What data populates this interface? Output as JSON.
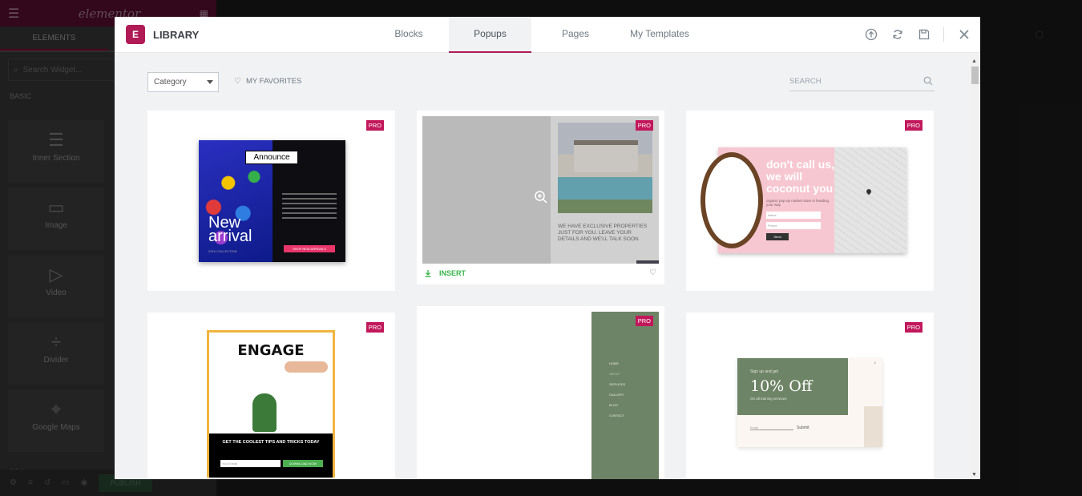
{
  "editor": {
    "logo": "elementor",
    "tab_elements": "ELEMENTS",
    "search_placeholder": "Search Widget...",
    "category_basic": "BASIC",
    "widgets": [
      "Inner Section",
      "Image",
      "Video",
      "Divider",
      "Google Maps"
    ],
    "category_pro": "PRO",
    "publish_label": "PUBLISH"
  },
  "library": {
    "logo_letter": "E",
    "title": "LIBRARY",
    "tabs": [
      "Blocks",
      "Popups",
      "Pages",
      "My Templates"
    ],
    "active_tab": "Popups"
  },
  "toolbar": {
    "category_select": "Category",
    "favorites_label": "MY FAVORITES",
    "search_placeholder": "SEARCH"
  },
  "cards": [
    {
      "badge": "PRO",
      "title_tag": "Announce",
      "headline": "New arrival",
      "sub": "2019 COLLECTION",
      "button": "SHOP NEW ARRIVALS"
    },
    {
      "badge": "PRO",
      "text": "WE HAVE EXCLUSIVE PROPERTIES JUST FOR YOU. LEAVE YOUR DETAILS AND WE'LL TALK SOON",
      "insert_label": "INSERT"
    },
    {
      "badge": "PRO",
      "headline": "don't call us, we will coconut you",
      "sub": "organic pop-up market store is heading your way",
      "field1": "Name",
      "field2": "Phone",
      "button": "Send"
    },
    {
      "badge": "PRO",
      "headline": "ENGAGE",
      "sub": "GET THE COOLEST TIPS AND TRICKS TODAY",
      "field": "Your Email",
      "button": "DOWNLOAD NOW"
    },
    {
      "badge": "PRO",
      "menu": [
        "HOME",
        "ABOUT",
        "SERVICES",
        "GALLERY",
        "BLOG",
        "CONTACT"
      ]
    },
    {
      "badge": "PRO",
      "small": "Sign up and get",
      "headline": "10% Off",
      "sub": "On all training services",
      "field": "Email",
      "button": "Submit"
    }
  ],
  "colors": {
    "brand": "#b01b56",
    "pro_badge": "#c2185b",
    "insert_green": "#39b54a",
    "sage": "#6e8466"
  }
}
